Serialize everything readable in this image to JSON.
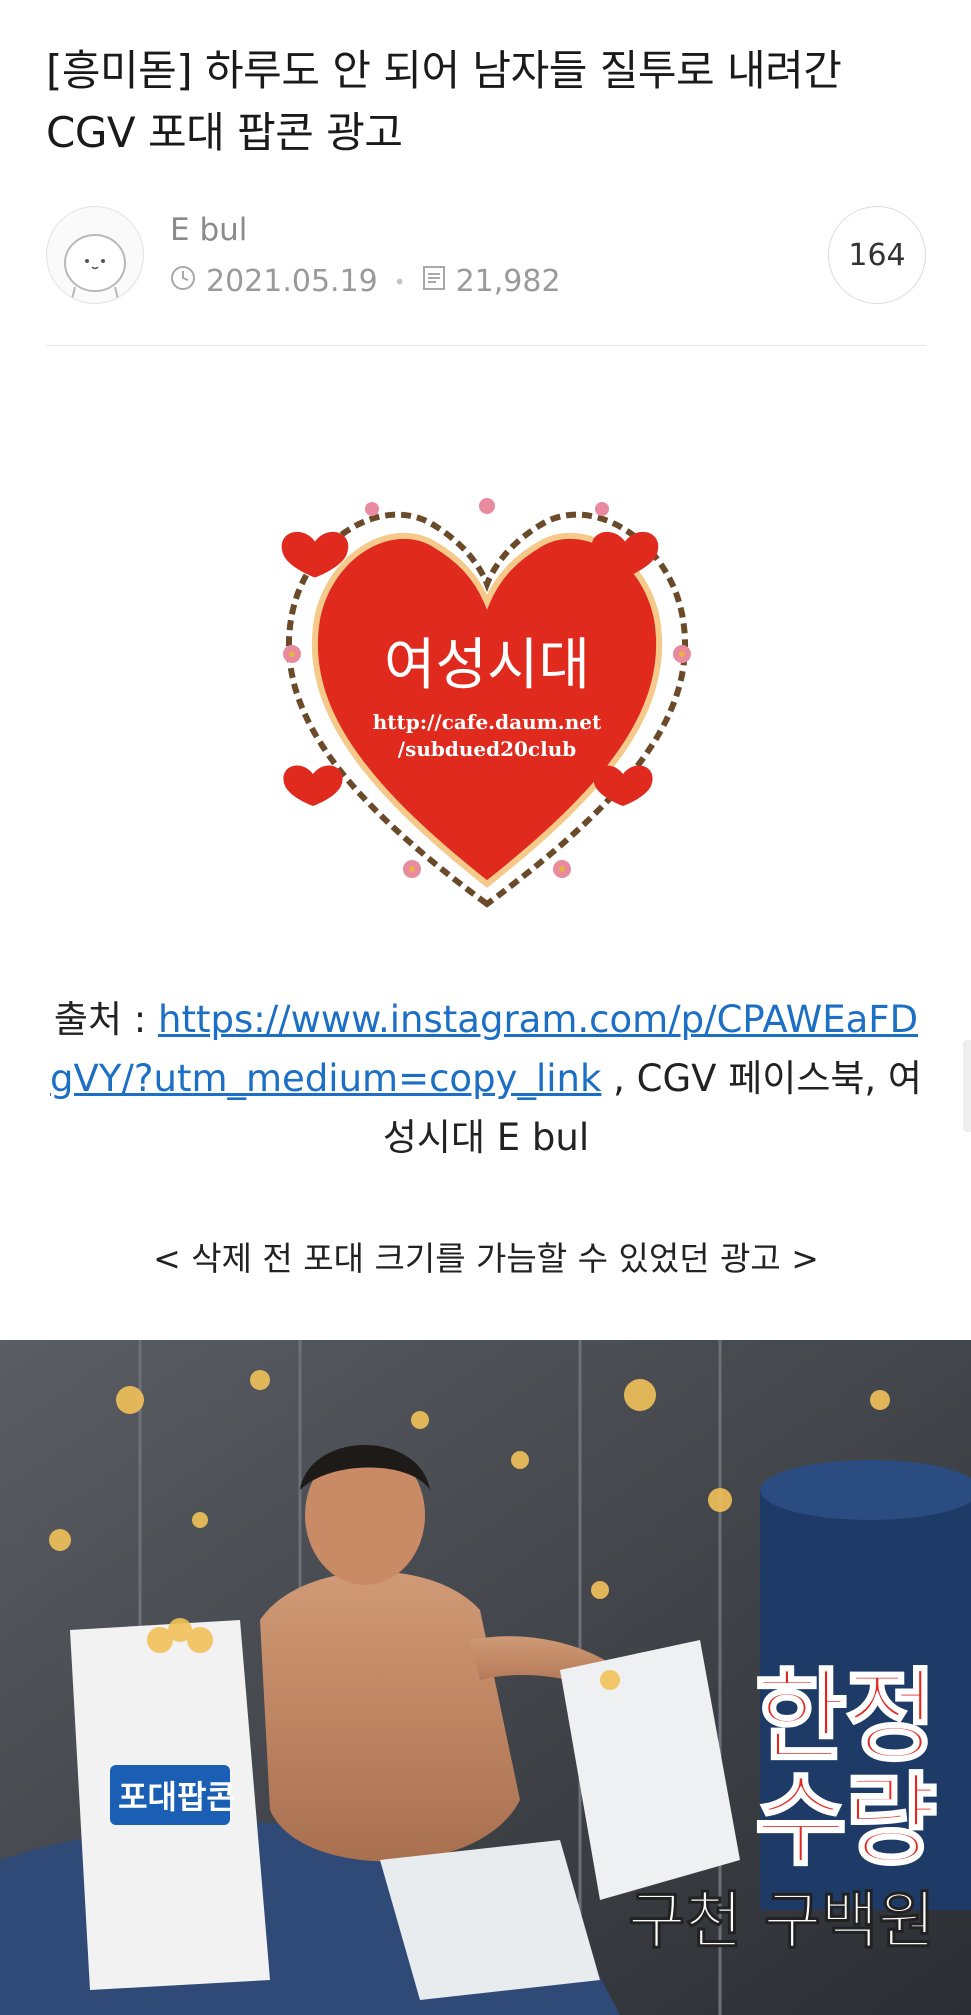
{
  "post": {
    "title": "[흥미돋] 하루도 안 되어 남자들 질투로 내려간 CGV 포대 팝콘 광고",
    "author": "E bul",
    "date": "2021.05.19",
    "views": "21,982",
    "comment_count": "164"
  },
  "logo": {
    "text_main": "여성시대",
    "url_line1": "http://cafe.daum.net",
    "url_line2": "/subdued20club"
  },
  "source": {
    "prefix": "출처 : ",
    "link": "https://www.instagram.com/p/CPAWEaFDgVY/?utm_medium=copy_link",
    "suffix": " , CGV 페이스북, 여성시대 E bul"
  },
  "caption": "< 삭제 전 포대 크기를 가늠할 수 있었던 광고 >",
  "ad": {
    "bag_label": "포대팝콘",
    "line1": "한정",
    "line2": "수량",
    "line3": "구천 구백원"
  },
  "colors": {
    "link": "#1b6fc4",
    "heart_red": "#e02a1e",
    "ad_red": "#e5261f"
  },
  "icons": [
    "clock-icon",
    "document-icon"
  ]
}
